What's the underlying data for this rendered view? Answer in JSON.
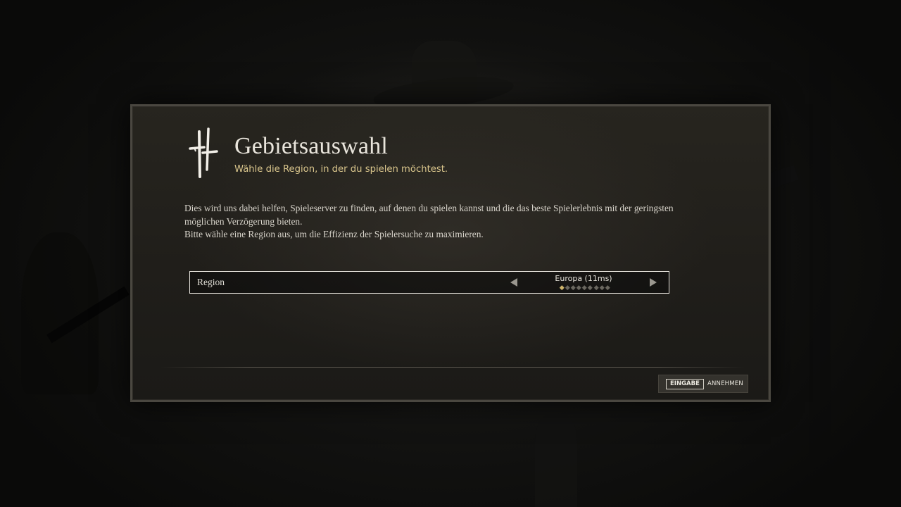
{
  "dialog": {
    "title": "Gebietsauswahl",
    "subtitle": "Wähle die Region, in der du spielen möchtest.",
    "description": [
      "Dies wird uns dabei helfen, Spieleserver zu finden, auf denen du spielen kannst und die das beste Spielerlebnis mit der geringsten",
      "möglichen Verzögerung bieten.",
      "Bitte wähle eine Region aus, um die Effizienz der Spielersuche zu maximieren."
    ],
    "logo_icon": "game-logo-icon"
  },
  "region": {
    "label": "Region",
    "value": "Europa (11ms)",
    "option_count": 9,
    "selected_index": 0,
    "prev_icon": "chevron-left-icon",
    "next_icon": "chevron-right-icon"
  },
  "footer": {
    "key_label": "EINGABE",
    "accept_label": "ANNEHMEN"
  },
  "colors": {
    "accent": "#d9c58c",
    "text": "#e9e5dc",
    "panel": "#23211c",
    "dot_active": "#cfb46a"
  }
}
